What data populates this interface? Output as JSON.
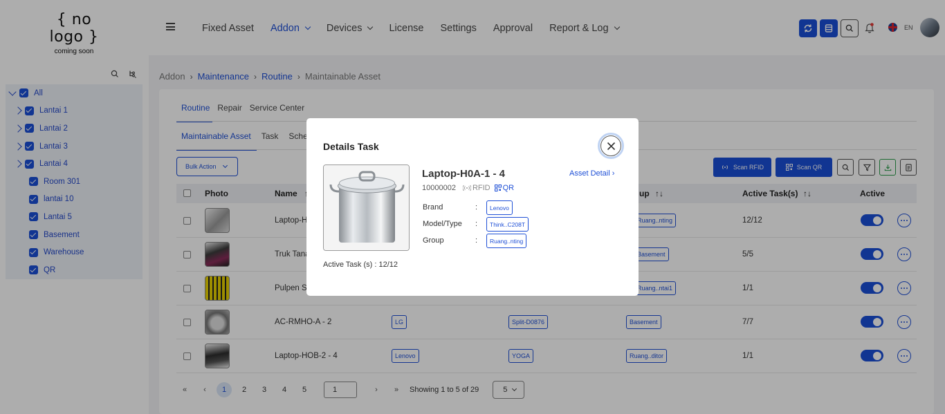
{
  "header": {
    "logo_main": "{ no logo }",
    "logo_sub": "coming soon",
    "nav": [
      {
        "label": "Fixed Asset",
        "active": false,
        "dropdown": false
      },
      {
        "label": "Addon",
        "active": true,
        "dropdown": true
      },
      {
        "label": "Devices",
        "active": false,
        "dropdown": true
      },
      {
        "label": "License",
        "active": false,
        "dropdown": false
      },
      {
        "label": "Settings",
        "active": false,
        "dropdown": false
      },
      {
        "label": "Approval",
        "active": false,
        "dropdown": false
      },
      {
        "label": "Report & Log",
        "active": false,
        "dropdown": true
      }
    ],
    "lang": "EN"
  },
  "sidebar": {
    "items": [
      {
        "label": "All",
        "level": 0
      },
      {
        "label": "Lantai 1",
        "level": 1
      },
      {
        "label": "Lantai 2",
        "level": 1
      },
      {
        "label": "Lantai 3",
        "level": 1
      },
      {
        "label": "Lantai 4",
        "level": 1
      },
      {
        "label": "Room 301",
        "level": 2
      },
      {
        "label": "lantai 10",
        "level": 2
      },
      {
        "label": "Lantai 5",
        "level": 2
      },
      {
        "label": "Basement",
        "level": 2
      },
      {
        "label": "Warehouse",
        "level": 2
      },
      {
        "label": "QR",
        "level": 2
      }
    ]
  },
  "breadcrumb": [
    "Addon",
    "Maintenance",
    "Routine",
    "Maintainable Asset"
  ],
  "tabs_primary": [
    "Routine",
    "Repair",
    "Service Center"
  ],
  "tabs_secondary": [
    "Maintainable Asset",
    "Task",
    "Sche"
  ],
  "toolbar": {
    "bulk_action": "Bulk Action",
    "scan_rfid": "Scan RFID",
    "scan_qr": "Scan QR"
  },
  "table": {
    "headers": {
      "photo": "Photo",
      "name": "Name",
      "group": "up",
      "active_tasks": "Active Task(s)",
      "active": "Active"
    },
    "rows": [
      {
        "name": "Laptop-H",
        "brand": "",
        "model": "",
        "group": "Ruang..nting",
        "tasks": "12/12",
        "photo": "pot"
      },
      {
        "name": "Truk Tana",
        "brand": "",
        "model": "",
        "group": "Basement",
        "tasks": "5/5",
        "photo": "laptop"
      },
      {
        "name": "Pulpen S",
        "brand": "",
        "model": "",
        "group": "Ruang..ntai1",
        "tasks": "1/1",
        "photo": "pens"
      },
      {
        "name": "AC-RMHO-A - 2",
        "brand": "LG",
        "model": "Split-D0876",
        "group": "Basement",
        "tasks": "7/7",
        "photo": "cooker"
      },
      {
        "name": "Laptop-HOB-2 - 4",
        "brand": "Lenovo",
        "model": "YOGA",
        "group": "Ruang..ditor",
        "tasks": "1/1",
        "photo": "laptop2"
      }
    ]
  },
  "pagination": {
    "pages": [
      "1",
      "2",
      "3",
      "4",
      "5"
    ],
    "current": "1",
    "input_value": "1",
    "showing": "Showing 1 to 5 of 29",
    "per_page": "5"
  },
  "modal": {
    "title": "Details Task",
    "asset_name": "Laptop-H0A-1 - 4",
    "asset_code": "10000002",
    "rfid_label": "RFID",
    "qr_label": "QR",
    "asset_detail_link": "Asset Detail ›",
    "fields": [
      {
        "label": "Brand",
        "value": "Lenovo"
      },
      {
        "label": "Model/Type",
        "value": "Think..C208T"
      },
      {
        "label": "Group",
        "value": "Ruang..nting"
      }
    ],
    "colon": ":",
    "active_task_label": "Active Task (s) :",
    "active_task_value": "12/12"
  },
  "colors": {
    "accent": "#1a4ed8",
    "link": "#1e4fd6"
  }
}
